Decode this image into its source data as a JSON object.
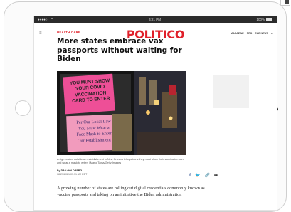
{
  "status_bar": {
    "left": "●●●●○",
    "center": "4:21 PM",
    "battery": "100%"
  },
  "site": {
    "logo": "POLITICO",
    "menu_icon": "hamburger-icon",
    "nav": [
      "MAGAZINE",
      "PRO",
      "E&E NEWS"
    ]
  },
  "article": {
    "section": "HEALTH CARE",
    "headline": "More states embrace vax passports without waiting for Biden",
    "photo": {
      "sign1": [
        "YOU MUST SHOW",
        "YOUR COVID",
        "VACCINATION",
        "CARD TO ENTER"
      ],
      "sign2": [
        "Per Our Local Law",
        "You Must Wear a",
        "Face Mask to Enter",
        "Our Establishment"
      ]
    },
    "caption": "A sign posted outside an establishment in New Orleans tells patrons they must show their vaccination card and wear a mask to enter. | Mario Tama/Getty Images",
    "author": "By DAN GOLDBERG",
    "date": "08/27/2021 07:31 AM EDT",
    "body": "A growing number of states are rolling out digital credentials commonly known as vaccine passports and taking on an initiative the Biden administration"
  },
  "colors": {
    "brand": "#e0202a"
  }
}
